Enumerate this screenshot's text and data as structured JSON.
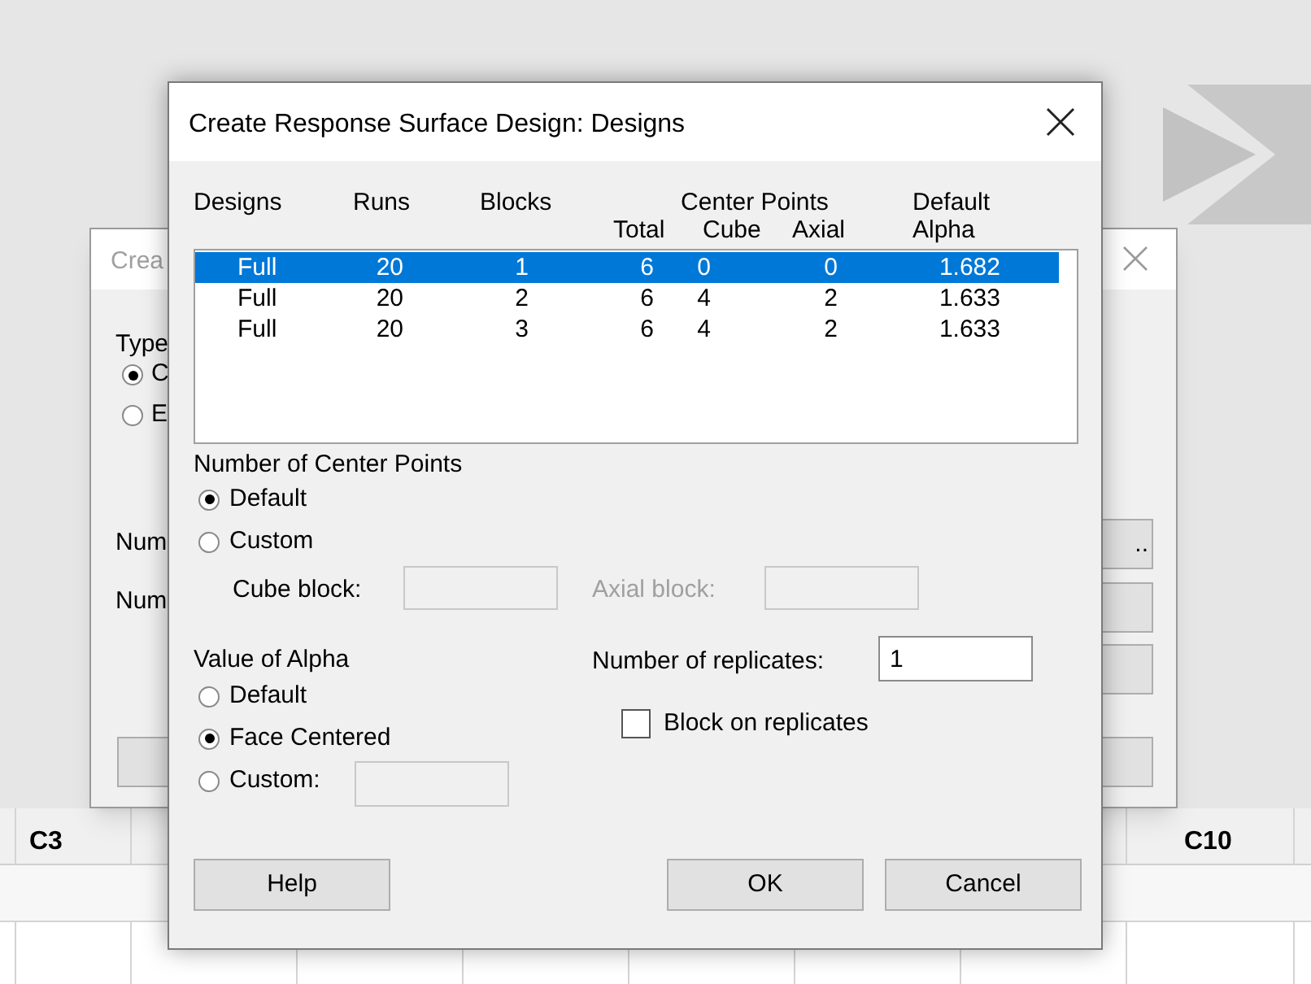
{
  "worksheet": {
    "columns": [
      "C3",
      "C10"
    ]
  },
  "background_dialog": {
    "title": "Crea",
    "group_label": "Type",
    "options": [
      {
        "label": "C",
        "selected": true
      },
      {
        "label": "E",
        "selected": false
      }
    ],
    "labels": [
      "Num",
      "Num"
    ],
    "button_text": ".."
  },
  "dialog": {
    "title": "Create Response Surface Design: Designs",
    "column_groups": [
      {
        "label": "Designs"
      },
      {
        "label": "Runs"
      },
      {
        "label": "Blocks"
      },
      {
        "label": "Center Points",
        "columns": [
          "Total",
          "Cube",
          "Axial"
        ]
      },
      {
        "label": "Default",
        "columns": [
          "Alpha"
        ]
      }
    ],
    "rows": [
      {
        "cells": [
          "Full",
          "20",
          "1",
          "6",
          "0",
          "0",
          "1.682"
        ],
        "selected": true
      },
      {
        "cells": [
          "Full",
          "20",
          "2",
          "6",
          "4",
          "2",
          "1.633"
        ],
        "selected": false
      },
      {
        "cells": [
          "Full",
          "20",
          "3",
          "6",
          "4",
          "2",
          "1.633"
        ],
        "selected": false
      }
    ],
    "center_points": {
      "title": "Number of Center Points",
      "options": [
        {
          "label": "Default",
          "selected": true
        },
        {
          "label": "Custom",
          "selected": false
        }
      ],
      "cube_block": {
        "label": "Cube block:",
        "disabled": false
      },
      "axial_block": {
        "label": "Axial block:",
        "disabled": true
      }
    },
    "alpha": {
      "title": "Value of Alpha",
      "options": [
        {
          "label": "Default",
          "selected": false
        },
        {
          "label": "Face Centered",
          "selected": true
        },
        {
          "label": "Custom:",
          "selected": false
        }
      ]
    },
    "replicates": {
      "label": "Number of replicates:",
      "value": "1"
    },
    "block_on_replicates": {
      "label": "Block on replicates",
      "checked": false
    },
    "buttons": [
      "Help",
      "OK",
      "Cancel"
    ]
  }
}
